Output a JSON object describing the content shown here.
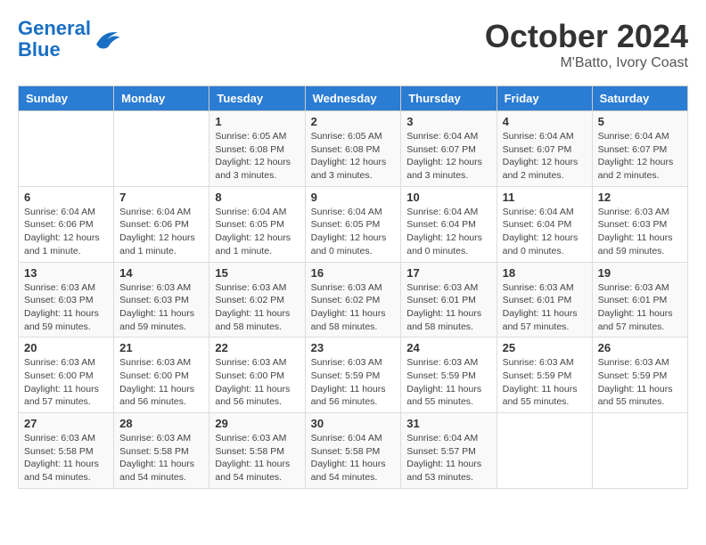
{
  "header": {
    "logo_line1": "General",
    "logo_line2": "Blue",
    "month": "October 2024",
    "location": "M'Batto, Ivory Coast"
  },
  "weekdays": [
    "Sunday",
    "Monday",
    "Tuesday",
    "Wednesday",
    "Thursday",
    "Friday",
    "Saturday"
  ],
  "weeks": [
    [
      {
        "day": "",
        "info": ""
      },
      {
        "day": "",
        "info": ""
      },
      {
        "day": "1",
        "info": "Sunrise: 6:05 AM\nSunset: 6:08 PM\nDaylight: 12 hours and 3 minutes."
      },
      {
        "day": "2",
        "info": "Sunrise: 6:05 AM\nSunset: 6:08 PM\nDaylight: 12 hours and 3 minutes."
      },
      {
        "day": "3",
        "info": "Sunrise: 6:04 AM\nSunset: 6:07 PM\nDaylight: 12 hours and 3 minutes."
      },
      {
        "day": "4",
        "info": "Sunrise: 6:04 AM\nSunset: 6:07 PM\nDaylight: 12 hours and 2 minutes."
      },
      {
        "day": "5",
        "info": "Sunrise: 6:04 AM\nSunset: 6:07 PM\nDaylight: 12 hours and 2 minutes."
      }
    ],
    [
      {
        "day": "6",
        "info": "Sunrise: 6:04 AM\nSunset: 6:06 PM\nDaylight: 12 hours and 1 minute."
      },
      {
        "day": "7",
        "info": "Sunrise: 6:04 AM\nSunset: 6:06 PM\nDaylight: 12 hours and 1 minute."
      },
      {
        "day": "8",
        "info": "Sunrise: 6:04 AM\nSunset: 6:05 PM\nDaylight: 12 hours and 1 minute."
      },
      {
        "day": "9",
        "info": "Sunrise: 6:04 AM\nSunset: 6:05 PM\nDaylight: 12 hours and 0 minutes."
      },
      {
        "day": "10",
        "info": "Sunrise: 6:04 AM\nSunset: 6:04 PM\nDaylight: 12 hours and 0 minutes."
      },
      {
        "day": "11",
        "info": "Sunrise: 6:04 AM\nSunset: 6:04 PM\nDaylight: 12 hours and 0 minutes."
      },
      {
        "day": "12",
        "info": "Sunrise: 6:03 AM\nSunset: 6:03 PM\nDaylight: 11 hours and 59 minutes."
      }
    ],
    [
      {
        "day": "13",
        "info": "Sunrise: 6:03 AM\nSunset: 6:03 PM\nDaylight: 11 hours and 59 minutes."
      },
      {
        "day": "14",
        "info": "Sunrise: 6:03 AM\nSunset: 6:03 PM\nDaylight: 11 hours and 59 minutes."
      },
      {
        "day": "15",
        "info": "Sunrise: 6:03 AM\nSunset: 6:02 PM\nDaylight: 11 hours and 58 minutes."
      },
      {
        "day": "16",
        "info": "Sunrise: 6:03 AM\nSunset: 6:02 PM\nDaylight: 11 hours and 58 minutes."
      },
      {
        "day": "17",
        "info": "Sunrise: 6:03 AM\nSunset: 6:01 PM\nDaylight: 11 hours and 58 minutes."
      },
      {
        "day": "18",
        "info": "Sunrise: 6:03 AM\nSunset: 6:01 PM\nDaylight: 11 hours and 57 minutes."
      },
      {
        "day": "19",
        "info": "Sunrise: 6:03 AM\nSunset: 6:01 PM\nDaylight: 11 hours and 57 minutes."
      }
    ],
    [
      {
        "day": "20",
        "info": "Sunrise: 6:03 AM\nSunset: 6:00 PM\nDaylight: 11 hours and 57 minutes."
      },
      {
        "day": "21",
        "info": "Sunrise: 6:03 AM\nSunset: 6:00 PM\nDaylight: 11 hours and 56 minutes."
      },
      {
        "day": "22",
        "info": "Sunrise: 6:03 AM\nSunset: 6:00 PM\nDaylight: 11 hours and 56 minutes."
      },
      {
        "day": "23",
        "info": "Sunrise: 6:03 AM\nSunset: 5:59 PM\nDaylight: 11 hours and 56 minutes."
      },
      {
        "day": "24",
        "info": "Sunrise: 6:03 AM\nSunset: 5:59 PM\nDaylight: 11 hours and 55 minutes."
      },
      {
        "day": "25",
        "info": "Sunrise: 6:03 AM\nSunset: 5:59 PM\nDaylight: 11 hours and 55 minutes."
      },
      {
        "day": "26",
        "info": "Sunrise: 6:03 AM\nSunset: 5:59 PM\nDaylight: 11 hours and 55 minutes."
      }
    ],
    [
      {
        "day": "27",
        "info": "Sunrise: 6:03 AM\nSunset: 5:58 PM\nDaylight: 11 hours and 54 minutes."
      },
      {
        "day": "28",
        "info": "Sunrise: 6:03 AM\nSunset: 5:58 PM\nDaylight: 11 hours and 54 minutes."
      },
      {
        "day": "29",
        "info": "Sunrise: 6:03 AM\nSunset: 5:58 PM\nDaylight: 11 hours and 54 minutes."
      },
      {
        "day": "30",
        "info": "Sunrise: 6:04 AM\nSunset: 5:58 PM\nDaylight: 11 hours and 54 minutes."
      },
      {
        "day": "31",
        "info": "Sunrise: 6:04 AM\nSunset: 5:57 PM\nDaylight: 11 hours and 53 minutes."
      },
      {
        "day": "",
        "info": ""
      },
      {
        "day": "",
        "info": ""
      }
    ]
  ]
}
